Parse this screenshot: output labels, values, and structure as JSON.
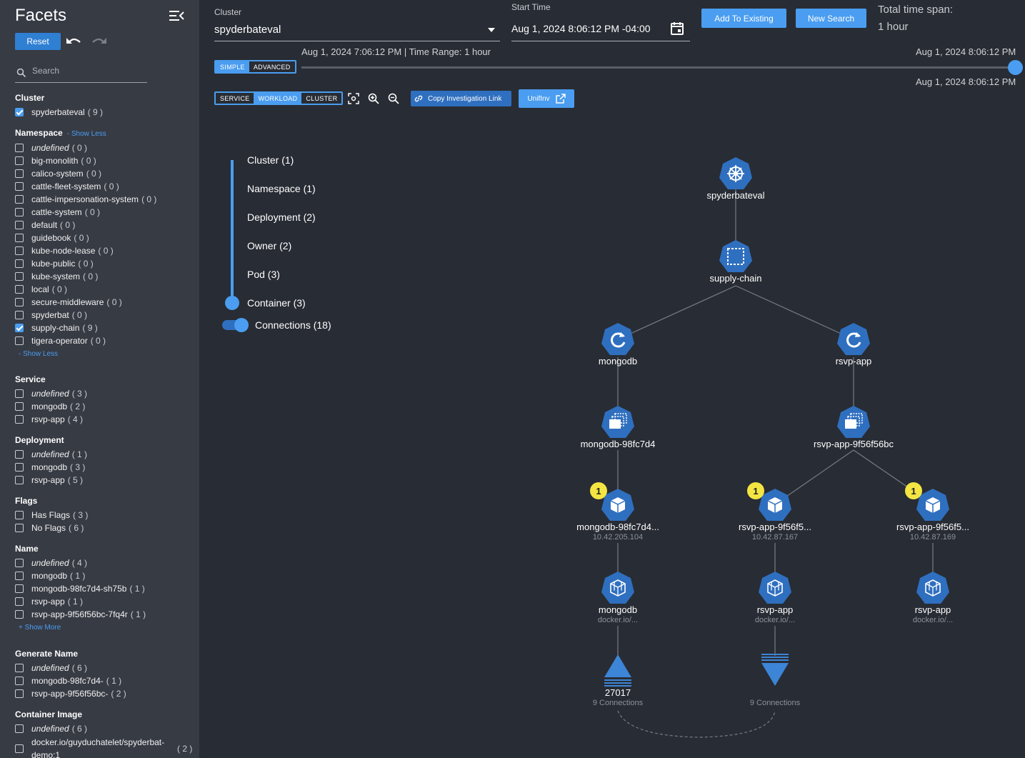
{
  "facets": {
    "title": "Facets",
    "reset_label": "Reset",
    "search_placeholder": "Search",
    "cluster": {
      "title": "Cluster",
      "items": [
        {
          "label": "spyderbateval",
          "count": "( 9 )",
          "checked": true
        }
      ]
    },
    "namespace": {
      "title": "Namespace",
      "show_less": "- Show Less",
      "show_less_bottom": "- Show Less",
      "items": [
        {
          "label": "undefined",
          "count": "( 0 )",
          "italic": true
        },
        {
          "label": "big-monolith",
          "count": "( 0 )"
        },
        {
          "label": "calico-system",
          "count": "( 0 )"
        },
        {
          "label": "cattle-fleet-system",
          "count": "( 0 )"
        },
        {
          "label": "cattle-impersonation-system",
          "count": "( 0 )"
        },
        {
          "label": "cattle-system",
          "count": "( 0 )"
        },
        {
          "label": "default",
          "count": "( 0 )"
        },
        {
          "label": "guidebook",
          "count": "( 0 )"
        },
        {
          "label": "kube-node-lease",
          "count": "( 0 )"
        },
        {
          "label": "kube-public",
          "count": "( 0 )"
        },
        {
          "label": "kube-system",
          "count": "( 0 )"
        },
        {
          "label": "local",
          "count": "( 0 )"
        },
        {
          "label": "secure-middleware",
          "count": "( 0 )"
        },
        {
          "label": "spyderbat",
          "count": "( 0 )"
        },
        {
          "label": "supply-chain",
          "count": "( 9 )",
          "checked": true
        },
        {
          "label": "tigera-operator",
          "count": "( 0 )"
        }
      ]
    },
    "service": {
      "title": "Service",
      "items": [
        {
          "label": "undefined",
          "count": "( 3 )",
          "italic": true
        },
        {
          "label": "mongodb",
          "count": "( 2 )"
        },
        {
          "label": "rsvp-app",
          "count": "( 4 )"
        }
      ]
    },
    "deployment": {
      "title": "Deployment",
      "items": [
        {
          "label": "undefined",
          "count": "( 1 )",
          "italic": true
        },
        {
          "label": "mongodb",
          "count": "( 3 )"
        },
        {
          "label": "rsvp-app",
          "count": "( 5 )"
        }
      ]
    },
    "flags": {
      "title": "Flags",
      "items": [
        {
          "label": "Has Flags",
          "count": "( 3 )"
        },
        {
          "label": "No Flags",
          "count": "( 6 )"
        }
      ]
    },
    "name": {
      "title": "Name",
      "show_more": "+ Show More",
      "items": [
        {
          "label": "undefined",
          "count": "( 4 )",
          "italic": true
        },
        {
          "label": "mongodb",
          "count": "( 1 )"
        },
        {
          "label": "mongodb-98fc7d4-sh75b",
          "count": "( 1 )"
        },
        {
          "label": "rsvp-app",
          "count": "( 1 )"
        },
        {
          "label": "rsvp-app-9f56f56bc-7fq4r",
          "count": "( 1 )"
        }
      ]
    },
    "generate_name": {
      "title": "Generate Name",
      "items": [
        {
          "label": "undefined",
          "count": "( 6 )",
          "italic": true
        },
        {
          "label": "mongodb-98fc7d4-",
          "count": "( 1 )"
        },
        {
          "label": "rsvp-app-9f56f56bc-",
          "count": "( 2 )"
        }
      ]
    },
    "container_image": {
      "title": "Container Image",
      "items": [
        {
          "label": "undefined",
          "count": "( 6 )",
          "italic": true
        },
        {
          "label": "docker.io/guyduchatelet/spyderbat-demo:1",
          "count": "( 2 )"
        }
      ]
    }
  },
  "header": {
    "cluster_label": "Cluster",
    "cluster_value": "spyderbateval",
    "start_label": "Start Time",
    "start_value": "Aug 1, 2024 8:06:12 PM -04:00",
    "add_existing": "Add To Existing",
    "new_search": "New Search",
    "total_span_label": "Total time span:",
    "total_span_value": "1 hour",
    "range_text": "Aug 1, 2024 7:06:12 PM | Time Range: 1 hour",
    "end_time_top": "Aug 1, 2024 8:06:12 PM",
    "end_time_bottom": "Aug 1, 2024 8:06:12 PM",
    "mode_simple": "SIMPLE",
    "mode_advanced": "ADVANCED",
    "view_service": "SERVICE",
    "view_workload": "WORKLOAD",
    "view_cluster": "CLUSTER",
    "copy_link": "Copy Investigation Link",
    "unifinv": "UnifInv"
  },
  "levels": {
    "cluster": "Cluster (1)",
    "namespace": "Namespace (1)",
    "deployment": "Deployment (2)",
    "owner": "Owner (2)",
    "pod": "Pod (3)",
    "container": "Container (3)",
    "connections": "Connections (18)"
  },
  "graph": {
    "cluster": "spyderbateval",
    "namespace": "supply-chain",
    "dep_mongo": "mongodb",
    "dep_rsvp": "rsvp-app",
    "rs_mongo": "mongodb-98fc7d4",
    "rs_rsvp": "rsvp-app-9f56f56bc",
    "pod1": "mongodb-98fc7d4...",
    "pod1_ip": "10.42.205.104",
    "pod2": "rsvp-app-9f56f5...",
    "pod2_ip": "10.42.87.167",
    "pod3": "rsvp-app-9f56f5...",
    "pod3_ip": "10.42.87.169",
    "c1": "mongodb",
    "c1_img": "docker.io/...",
    "c2": "rsvp-app",
    "c2_img": "docker.io/...",
    "c3": "rsvp-app",
    "c3_img": "docker.io/...",
    "badge": "1",
    "conn_in_port": "27017",
    "conn_in": "9 Connections",
    "conn_out": "9 Connections"
  },
  "colors": {
    "accent": "#4a9df0",
    "node": "#2f6fbf",
    "badge": "#f4e542"
  }
}
